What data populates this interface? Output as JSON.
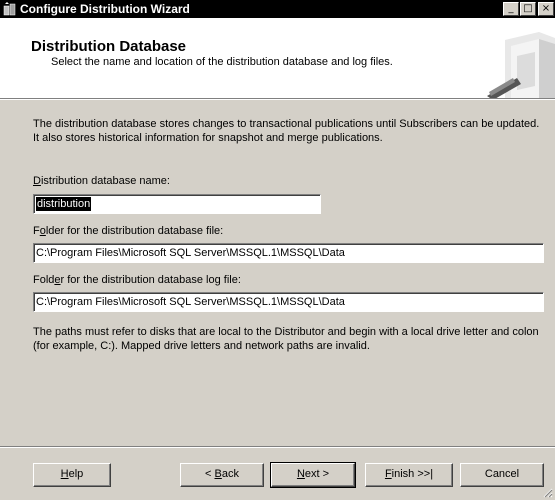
{
  "window": {
    "title": "Configure Distribution Wizard",
    "controls": {
      "minimize": "_",
      "maximize": "□",
      "close": "×"
    }
  },
  "header": {
    "title": "Distribution Database",
    "subtitle": "Select the name and location of the distribution database and log files."
  },
  "intro": {
    "text": "The distribution database stores changes to transactional publications until Subscribers can be updated. It also stores historical information for snapshot and merge publications."
  },
  "fields": {
    "db_name": {
      "label_pre": "",
      "label_key": "D",
      "label_post": "istribution database name:",
      "value": "distribution"
    },
    "db_folder": {
      "label_pre": "F",
      "label_key": "o",
      "label_post": "lder for the distribution database file:",
      "value": "C:\\Program Files\\Microsoft SQL Server\\MSSQL.1\\MSSQL\\Data"
    },
    "log_folder": {
      "label_pre": "Fold",
      "label_key": "e",
      "label_post": "r for the distribution database log file:",
      "value": "C:\\Program Files\\Microsoft SQL Server\\MSSQL.1\\MSSQL\\Data"
    }
  },
  "note": {
    "text": "The paths must refer to disks that are local to the Distributor and begin with a local drive letter and colon (for example, C:). Mapped drive letters and network paths are invalid."
  },
  "buttons": {
    "help": {
      "pre": "",
      "key": "H",
      "post": "elp"
    },
    "back": {
      "pre": "< ",
      "key": "B",
      "post": "ack"
    },
    "next": {
      "pre": "",
      "key": "N",
      "post": "ext >"
    },
    "finish": {
      "pre": "",
      "key": "F",
      "post": "inish >>|"
    },
    "cancel": {
      "pre": "Cancel",
      "key": "",
      "post": ""
    }
  },
  "icons": {
    "app": "wizard-app-icon",
    "header_graphic": "server-graphic",
    "resize": "resize-grip-icon"
  }
}
